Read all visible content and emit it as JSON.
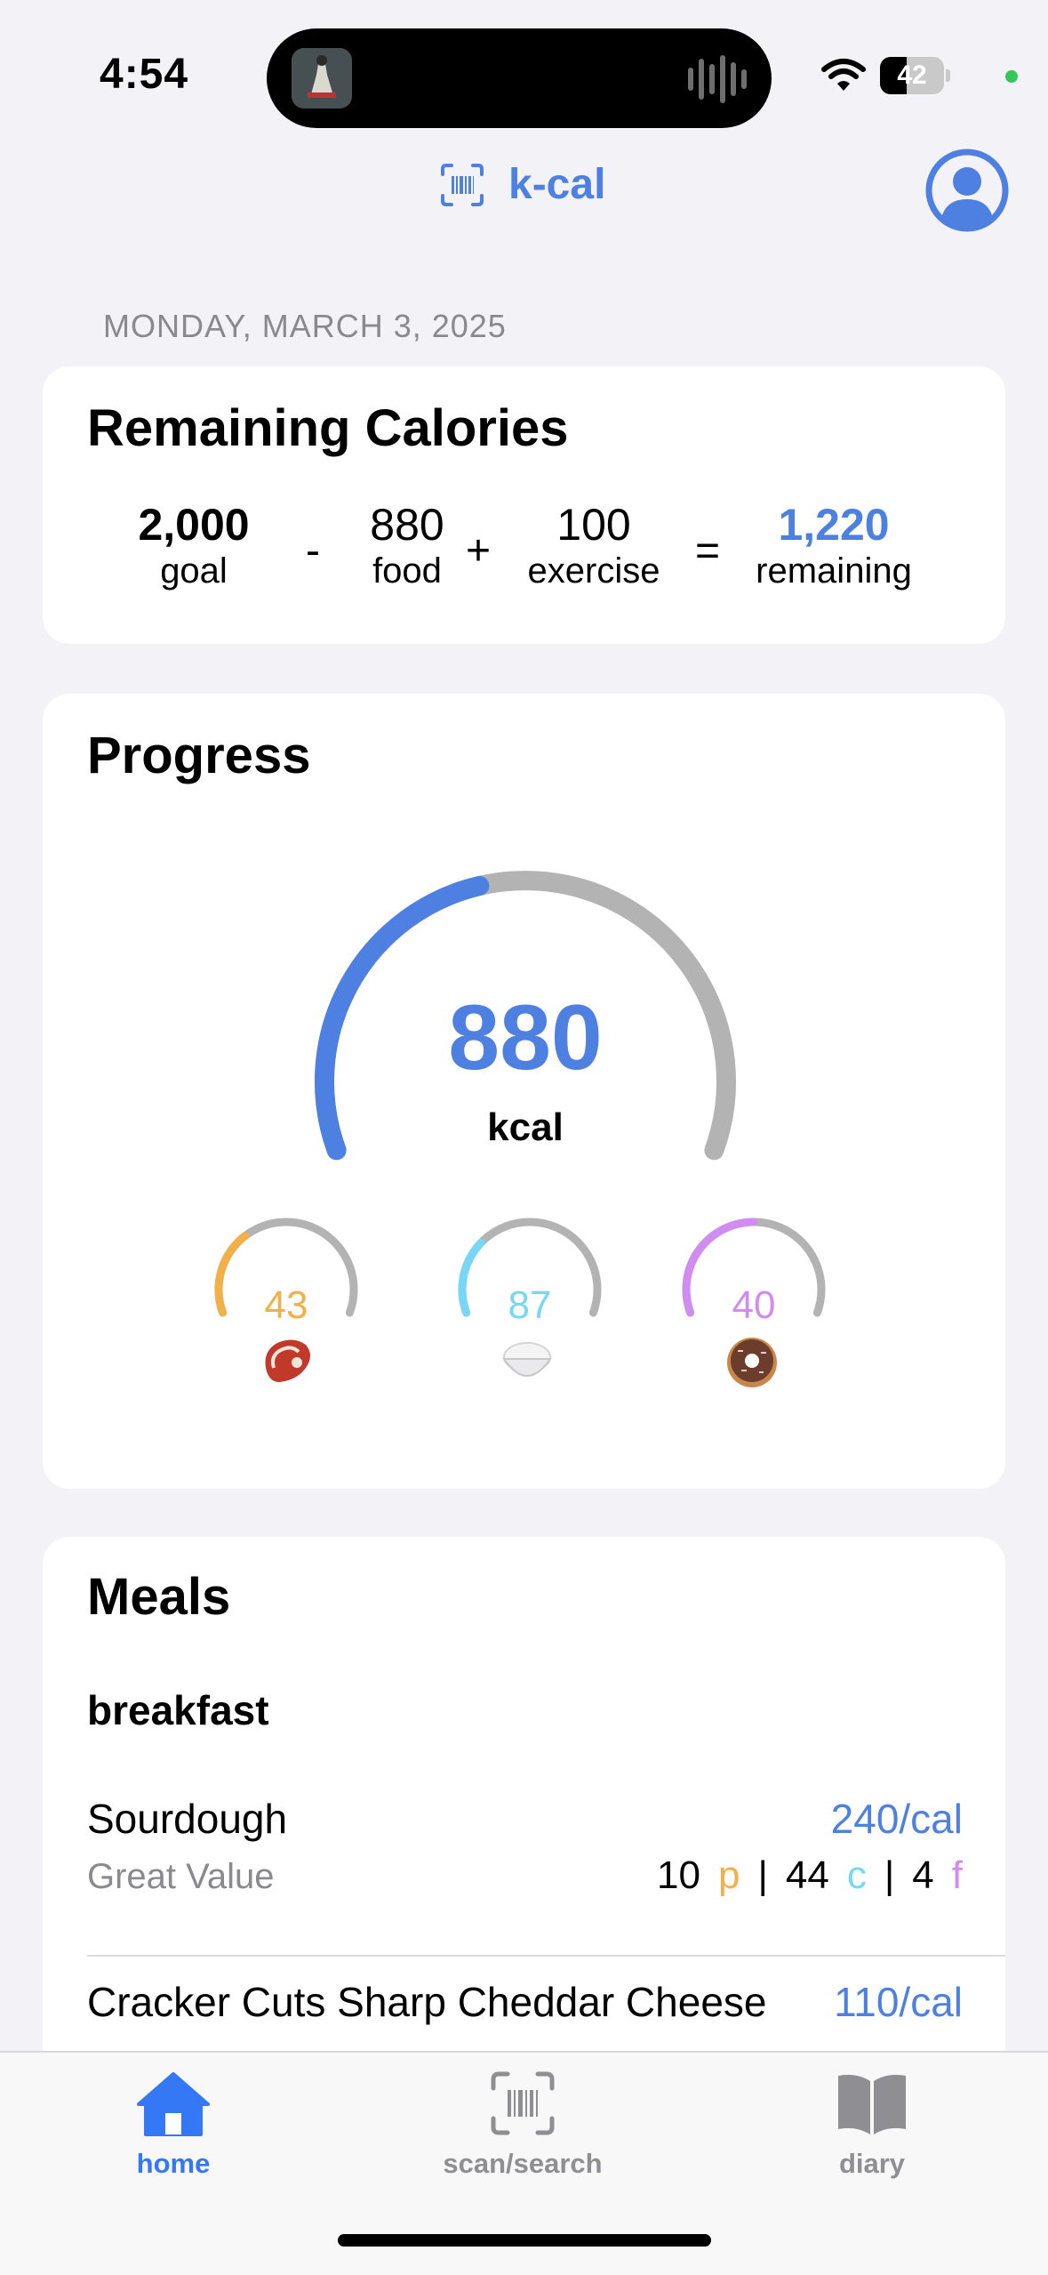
{
  "status_bar": {
    "time": "4:54",
    "battery": "42",
    "battery_level": 0.42
  },
  "header": {
    "title": "k-cal"
  },
  "date": "MONDAY, MARCH 3, 2025",
  "remaining": {
    "title": "Remaining Calories",
    "goal_value": "2,000",
    "goal_label": "goal",
    "op_minus": "-",
    "food_value": "880",
    "food_label": "food",
    "op_plus": "+",
    "exercise_value": "100",
    "exercise_label": "exercise",
    "op_equals": "=",
    "remaining_value": "1,220",
    "remaining_label": "remaining"
  },
  "progress": {
    "title": "Progress",
    "kcal_value": "880",
    "kcal_unit": "kcal",
    "kcal_fraction": 0.44,
    "macros": [
      {
        "value": "43",
        "icon": "steak-icon",
        "color": "#f2b04a",
        "fraction": 0.33
      },
      {
        "value": "87",
        "icon": "rice-bowl-icon",
        "color": "#78d7f7",
        "fraction": 0.29
      },
      {
        "value": "40",
        "icon": "donut-icon",
        "color": "#d08cf0",
        "fraction": 0.5
      }
    ]
  },
  "meals": {
    "title": "Meals",
    "section": "breakfast",
    "items": [
      {
        "name": "Sourdough",
        "calories": "240/cal",
        "brand": "Great Value",
        "p": "10",
        "c": "44",
        "f": "4"
      },
      {
        "name": "Cracker Cuts Sharp Cheddar Cheese",
        "calories": "110/cal"
      }
    ],
    "p_label": "p",
    "c_label": "c",
    "f_label": "f",
    "sep": "|"
  },
  "tabs": [
    {
      "label": "home",
      "active": true
    },
    {
      "label": "scan/search",
      "active": false
    },
    {
      "label": "diary",
      "active": false
    }
  ],
  "colors": {
    "accent": "#4e80e2",
    "protein": "#f2b04a",
    "carbs": "#78d7f7",
    "fat": "#d08cf0",
    "inactive": "#8e8e93",
    "track": "#b3b3b3"
  }
}
